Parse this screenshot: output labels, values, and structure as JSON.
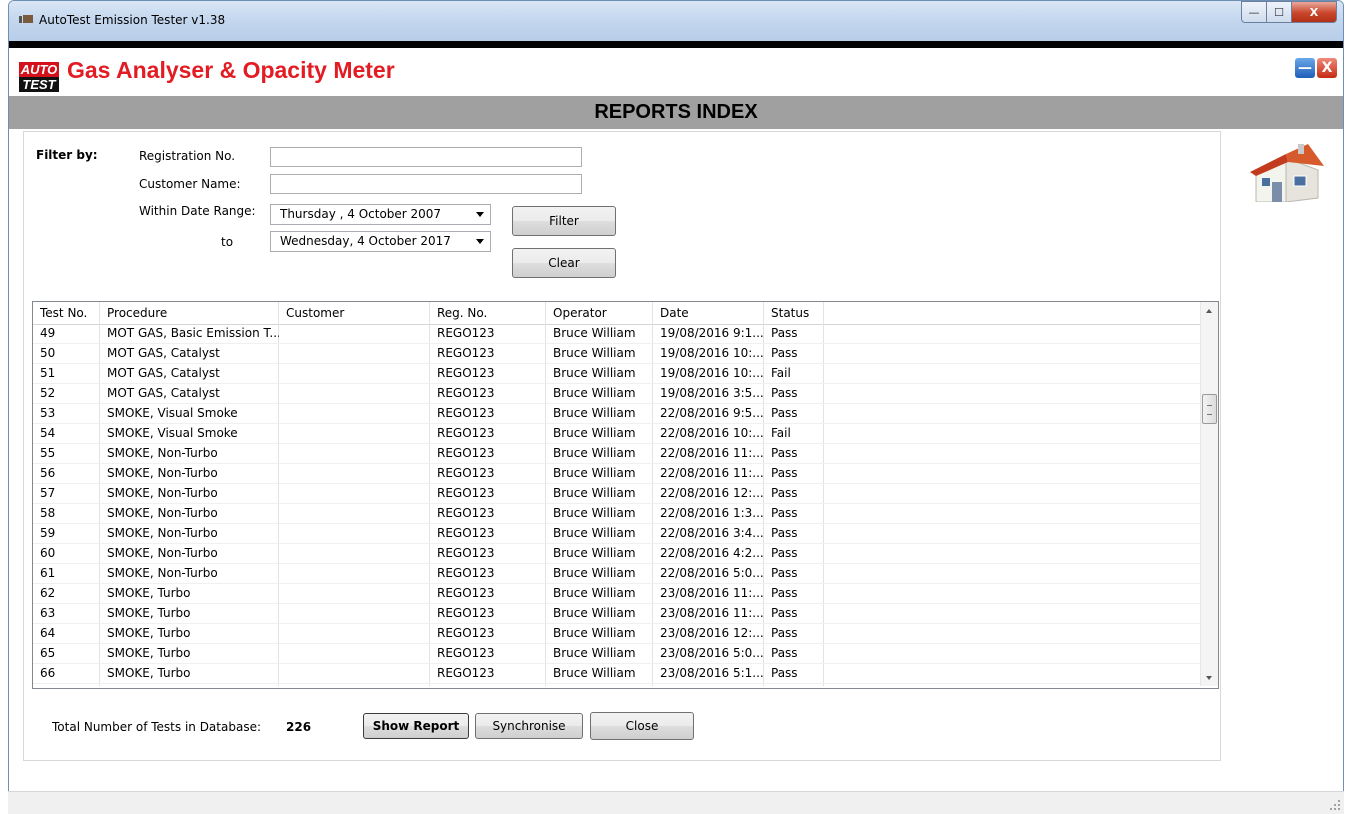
{
  "window": {
    "title": "AutoTest Emission Tester v1.38",
    "controls": {
      "minimize": "—",
      "maximize": "☐",
      "close": "X"
    }
  },
  "app": {
    "logo_top": "AUTO",
    "logo_bottom": "TEST",
    "title": "Gas Analyser & Opacity Meter",
    "min_label": "—",
    "close_label": "X"
  },
  "banner": "REPORTS INDEX",
  "filter": {
    "heading": "Filter by:",
    "registration_label": "Registration No.",
    "registration_value": "",
    "customer_label": "Customer Name:",
    "customer_value": "",
    "date_range_label": "Within Date Range:",
    "to_label": "to",
    "date_from": "Thursday  ,  4  October  2007",
    "date_to": "Wednesday,  4  October  2017",
    "filter_button": "Filter",
    "clear_button": "Clear"
  },
  "table": {
    "columns": [
      "Test No.",
      "Procedure",
      "Customer",
      "Reg. No.",
      "Operator",
      "Date",
      "Status"
    ],
    "rows": [
      [
        "49",
        "MOT GAS, Basic Emission T...",
        "",
        "REGO123",
        "Bruce William",
        "19/08/2016 9:1...",
        "Pass"
      ],
      [
        "50",
        "MOT GAS, Catalyst",
        "",
        "REGO123",
        "Bruce William",
        "19/08/2016 10:...",
        "Pass"
      ],
      [
        "51",
        "MOT GAS, Catalyst",
        "",
        "REGO123",
        "Bruce William",
        "19/08/2016 10:...",
        "Fail"
      ],
      [
        "52",
        "MOT GAS, Catalyst",
        "",
        "REGO123",
        "Bruce William",
        "19/08/2016 3:5...",
        "Pass"
      ],
      [
        "53",
        "SMOKE, Visual Smoke",
        "",
        "REGO123",
        "Bruce William",
        "22/08/2016 9:5...",
        "Pass"
      ],
      [
        "54",
        "SMOKE, Visual Smoke",
        "",
        "REGO123",
        "Bruce William",
        "22/08/2016 10:...",
        "Fail"
      ],
      [
        "55",
        "SMOKE, Non-Turbo",
        "",
        "REGO123",
        "Bruce William",
        "22/08/2016 11:...",
        "Pass"
      ],
      [
        "56",
        "SMOKE, Non-Turbo",
        "",
        "REGO123",
        "Bruce William",
        "22/08/2016 11:...",
        "Pass"
      ],
      [
        "57",
        "SMOKE, Non-Turbo",
        "",
        "REGO123",
        "Bruce William",
        "22/08/2016 12:...",
        "Pass"
      ],
      [
        "58",
        "SMOKE, Non-Turbo",
        "",
        "REGO123",
        "Bruce William",
        "22/08/2016 1:3...",
        "Pass"
      ],
      [
        "59",
        "SMOKE, Non-Turbo",
        "",
        "REGO123",
        "Bruce William",
        "22/08/2016 3:4...",
        "Pass"
      ],
      [
        "60",
        "SMOKE, Non-Turbo",
        "",
        "REGO123",
        "Bruce William",
        "22/08/2016 4:2...",
        "Pass"
      ],
      [
        "61",
        "SMOKE, Non-Turbo",
        "",
        "REGO123",
        "Bruce William",
        "22/08/2016 5:0...",
        "Pass"
      ],
      [
        "62",
        "SMOKE, Turbo",
        "",
        "REGO123",
        "Bruce William",
        "23/08/2016 11:...",
        "Pass"
      ],
      [
        "63",
        "SMOKE, Turbo",
        "",
        "REGO123",
        "Bruce William",
        "23/08/2016 11:...",
        "Pass"
      ],
      [
        "64",
        "SMOKE, Turbo",
        "",
        "REGO123",
        "Bruce William",
        "23/08/2016 12:...",
        "Pass"
      ],
      [
        "65",
        "SMOKE, Turbo",
        "",
        "REGO123",
        "Bruce William",
        "23/08/2016 5:0...",
        "Pass"
      ],
      [
        "66",
        "SMOKE, Turbo",
        "",
        "REGO123",
        "Bruce William",
        "23/08/2016 5:1...",
        "Pass"
      ]
    ]
  },
  "footer": {
    "total_label": "Total Number of Tests in Database:",
    "total_value": "226",
    "show_report": "Show Report",
    "synchronise": "Synchronise",
    "close": "Close"
  },
  "icons": {
    "home": "house-icon"
  }
}
